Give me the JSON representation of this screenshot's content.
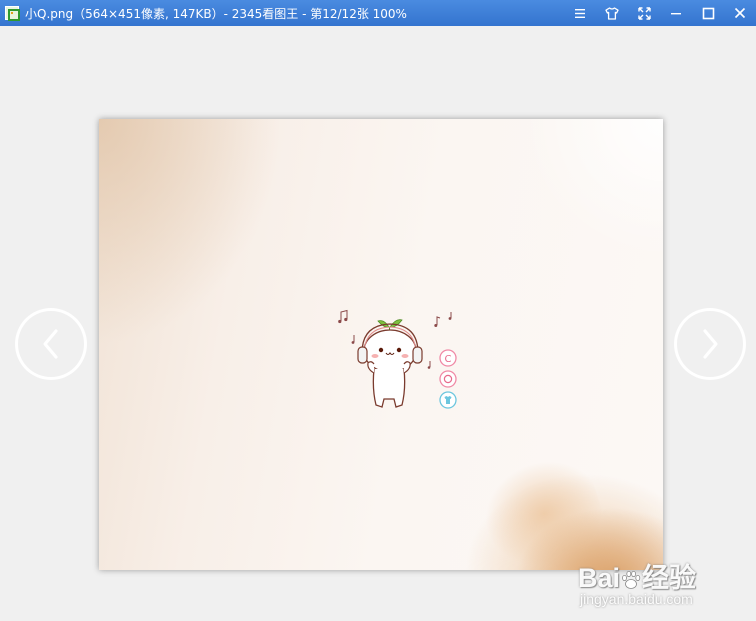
{
  "window": {
    "title": "小Q.png（564×451像素, 147KB）- 2345看图王 - 第12/12张 100%"
  },
  "controls": {
    "menu_icon": "menu-icon",
    "skin_icon": "tshirt-icon",
    "fullscreen_icon": "fullscreen-icon",
    "minimize_icon": "minimize-icon",
    "maximize_icon": "maximize-icon",
    "close_icon": "close-icon"
  },
  "image": {
    "width": 564,
    "height": 451
  },
  "navigation": {
    "prev_icon": "chevron-left-icon",
    "next_icon": "chevron-right-icon"
  },
  "watermark": {
    "brand": "Bai",
    "brand_suffix": "经验",
    "url": "jingyan.baidu.com"
  },
  "colors": {
    "titlebar": "#3b7fd6",
    "background": "#f0f0f0",
    "title_text": "#ffffff"
  }
}
